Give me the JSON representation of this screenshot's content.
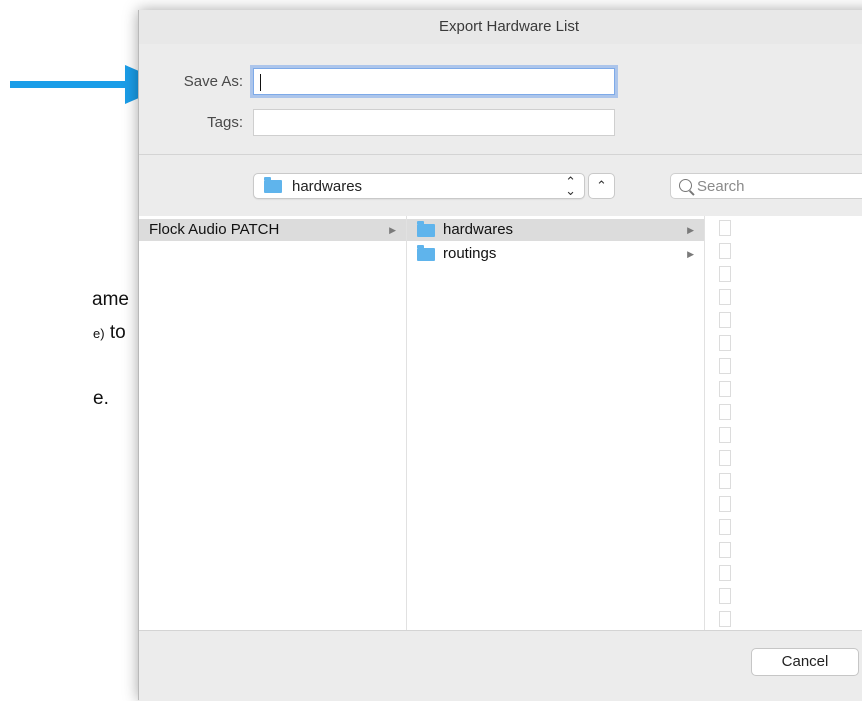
{
  "background_text": {
    "line1": "ame",
    "line2a": "e)",
    "line2b": "to",
    "line3": "e."
  },
  "dialog": {
    "title": "Export Hardware List",
    "save_as_label": "Save As:",
    "save_as_value": "",
    "tags_label": "Tags:",
    "tags_value": "",
    "location": "hardwares",
    "search_placeholder": "Search",
    "cancel_label": "Cancel"
  },
  "columns": [
    {
      "items": [
        {
          "label": "Flock Audio PATCH",
          "selected": true,
          "has_children": true
        }
      ]
    },
    {
      "items": [
        {
          "label": "hardwares",
          "selected": true,
          "has_children": true,
          "icon": "folder-icon"
        },
        {
          "label": "routings",
          "selected": false,
          "has_children": true,
          "icon": "folder-icon"
        }
      ]
    }
  ],
  "colors": {
    "arrow": "#1a9de8",
    "folder": "#5fb4ec",
    "focus_ring": "#7eaae8",
    "selection": "#dcdcdc"
  },
  "icons": {
    "popup_arrows": "⌃⌄",
    "up": "⌃",
    "disclosure": "▶"
  }
}
